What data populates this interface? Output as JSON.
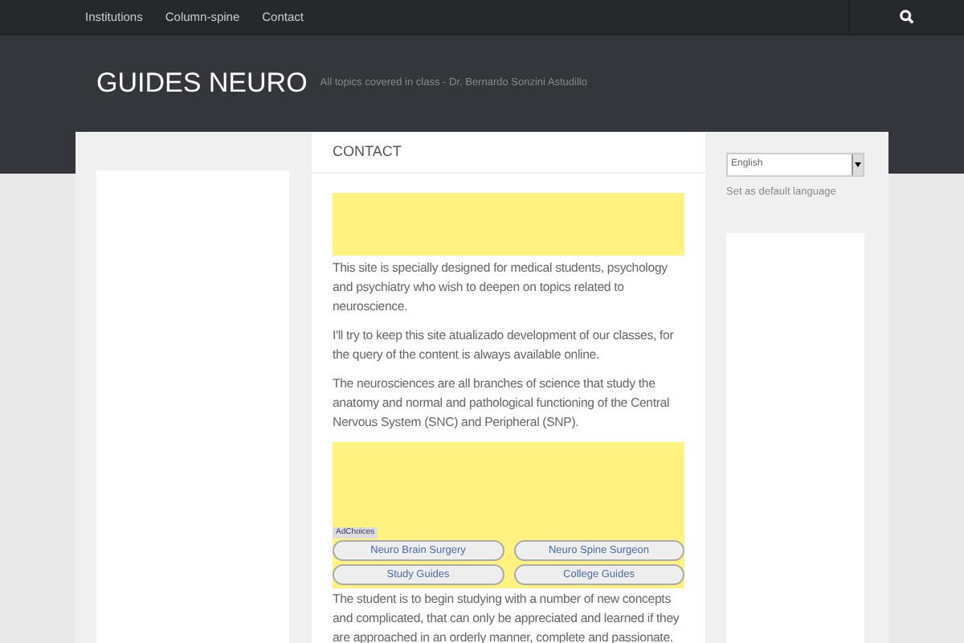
{
  "nav": {
    "items": [
      {
        "label": "Institutions"
      },
      {
        "label": "Column-spine"
      },
      {
        "label": "Contact"
      }
    ]
  },
  "header": {
    "title": "GUIDES NEURO",
    "tagline": "All topics covered in class - Dr. Bernardo Sonzini Astudillo"
  },
  "main": {
    "heading": "CONTACT",
    "paragraphs_top": [
      "This site is specially designed for medical students, psychology and psychiatry who wish to deepen on topics related to neuroscience.",
      "I'll try to keep this site atualizado development of our classes, for the query of the content is always available online.",
      "The neurosciences are all branches of science that study the anatomy and normal and pathological functioning of the Central Nervous System (SNC) and Peripheral (SNP)."
    ],
    "ad": {
      "badge": "AdChoices",
      "links": [
        "Neuro Brain Surgery",
        "Neuro Spine Surgeon",
        "Study Guides",
        "College Guides"
      ]
    },
    "paragraphs_bottom": [
      "The student is to begin studying with a number of new concepts and complicated, that can only be appreciated and learned if they are approached in an orderly manner, complete and passionate."
    ]
  },
  "sidebar": {
    "language": {
      "value": "English"
    },
    "default_link": "Set as default language"
  }
}
